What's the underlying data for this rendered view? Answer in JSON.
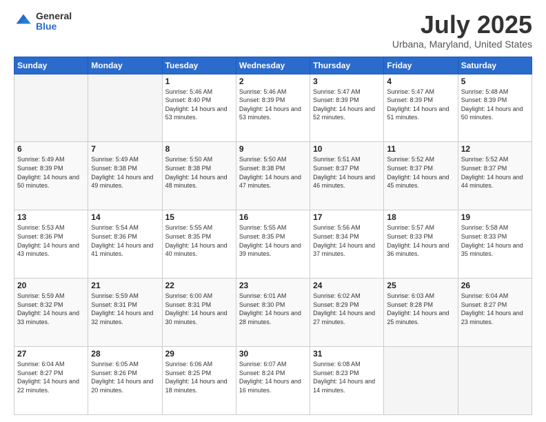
{
  "logo": {
    "general": "General",
    "blue": "Blue"
  },
  "title": {
    "month": "July 2025",
    "location": "Urbana, Maryland, United States"
  },
  "days_of_week": [
    "Sunday",
    "Monday",
    "Tuesday",
    "Wednesday",
    "Thursday",
    "Friday",
    "Saturday"
  ],
  "weeks": [
    [
      {
        "day": "",
        "info": ""
      },
      {
        "day": "",
        "info": ""
      },
      {
        "day": "1",
        "info": "Sunrise: 5:46 AM\nSunset: 8:40 PM\nDaylight: 14 hours and 53 minutes."
      },
      {
        "day": "2",
        "info": "Sunrise: 5:46 AM\nSunset: 8:39 PM\nDaylight: 14 hours and 53 minutes."
      },
      {
        "day": "3",
        "info": "Sunrise: 5:47 AM\nSunset: 8:39 PM\nDaylight: 14 hours and 52 minutes."
      },
      {
        "day": "4",
        "info": "Sunrise: 5:47 AM\nSunset: 8:39 PM\nDaylight: 14 hours and 51 minutes."
      },
      {
        "day": "5",
        "info": "Sunrise: 5:48 AM\nSunset: 8:39 PM\nDaylight: 14 hours and 50 minutes."
      }
    ],
    [
      {
        "day": "6",
        "info": "Sunrise: 5:49 AM\nSunset: 8:39 PM\nDaylight: 14 hours and 50 minutes."
      },
      {
        "day": "7",
        "info": "Sunrise: 5:49 AM\nSunset: 8:38 PM\nDaylight: 14 hours and 49 minutes."
      },
      {
        "day": "8",
        "info": "Sunrise: 5:50 AM\nSunset: 8:38 PM\nDaylight: 14 hours and 48 minutes."
      },
      {
        "day": "9",
        "info": "Sunrise: 5:50 AM\nSunset: 8:38 PM\nDaylight: 14 hours and 47 minutes."
      },
      {
        "day": "10",
        "info": "Sunrise: 5:51 AM\nSunset: 8:37 PM\nDaylight: 14 hours and 46 minutes."
      },
      {
        "day": "11",
        "info": "Sunrise: 5:52 AM\nSunset: 8:37 PM\nDaylight: 14 hours and 45 minutes."
      },
      {
        "day": "12",
        "info": "Sunrise: 5:52 AM\nSunset: 8:37 PM\nDaylight: 14 hours and 44 minutes."
      }
    ],
    [
      {
        "day": "13",
        "info": "Sunrise: 5:53 AM\nSunset: 8:36 PM\nDaylight: 14 hours and 43 minutes."
      },
      {
        "day": "14",
        "info": "Sunrise: 5:54 AM\nSunset: 8:36 PM\nDaylight: 14 hours and 41 minutes."
      },
      {
        "day": "15",
        "info": "Sunrise: 5:55 AM\nSunset: 8:35 PM\nDaylight: 14 hours and 40 minutes."
      },
      {
        "day": "16",
        "info": "Sunrise: 5:55 AM\nSunset: 8:35 PM\nDaylight: 14 hours and 39 minutes."
      },
      {
        "day": "17",
        "info": "Sunrise: 5:56 AM\nSunset: 8:34 PM\nDaylight: 14 hours and 37 minutes."
      },
      {
        "day": "18",
        "info": "Sunrise: 5:57 AM\nSunset: 8:33 PM\nDaylight: 14 hours and 36 minutes."
      },
      {
        "day": "19",
        "info": "Sunrise: 5:58 AM\nSunset: 8:33 PM\nDaylight: 14 hours and 35 minutes."
      }
    ],
    [
      {
        "day": "20",
        "info": "Sunrise: 5:59 AM\nSunset: 8:32 PM\nDaylight: 14 hours and 33 minutes."
      },
      {
        "day": "21",
        "info": "Sunrise: 5:59 AM\nSunset: 8:31 PM\nDaylight: 14 hours and 32 minutes."
      },
      {
        "day": "22",
        "info": "Sunrise: 6:00 AM\nSunset: 8:31 PM\nDaylight: 14 hours and 30 minutes."
      },
      {
        "day": "23",
        "info": "Sunrise: 6:01 AM\nSunset: 8:30 PM\nDaylight: 14 hours and 28 minutes."
      },
      {
        "day": "24",
        "info": "Sunrise: 6:02 AM\nSunset: 8:29 PM\nDaylight: 14 hours and 27 minutes."
      },
      {
        "day": "25",
        "info": "Sunrise: 6:03 AM\nSunset: 8:28 PM\nDaylight: 14 hours and 25 minutes."
      },
      {
        "day": "26",
        "info": "Sunrise: 6:04 AM\nSunset: 8:27 PM\nDaylight: 14 hours and 23 minutes."
      }
    ],
    [
      {
        "day": "27",
        "info": "Sunrise: 6:04 AM\nSunset: 8:27 PM\nDaylight: 14 hours and 22 minutes."
      },
      {
        "day": "28",
        "info": "Sunrise: 6:05 AM\nSunset: 8:26 PM\nDaylight: 14 hours and 20 minutes."
      },
      {
        "day": "29",
        "info": "Sunrise: 6:06 AM\nSunset: 8:25 PM\nDaylight: 14 hours and 18 minutes."
      },
      {
        "day": "30",
        "info": "Sunrise: 6:07 AM\nSunset: 8:24 PM\nDaylight: 14 hours and 16 minutes."
      },
      {
        "day": "31",
        "info": "Sunrise: 6:08 AM\nSunset: 8:23 PM\nDaylight: 14 hours and 14 minutes."
      },
      {
        "day": "",
        "info": ""
      },
      {
        "day": "",
        "info": ""
      }
    ]
  ]
}
